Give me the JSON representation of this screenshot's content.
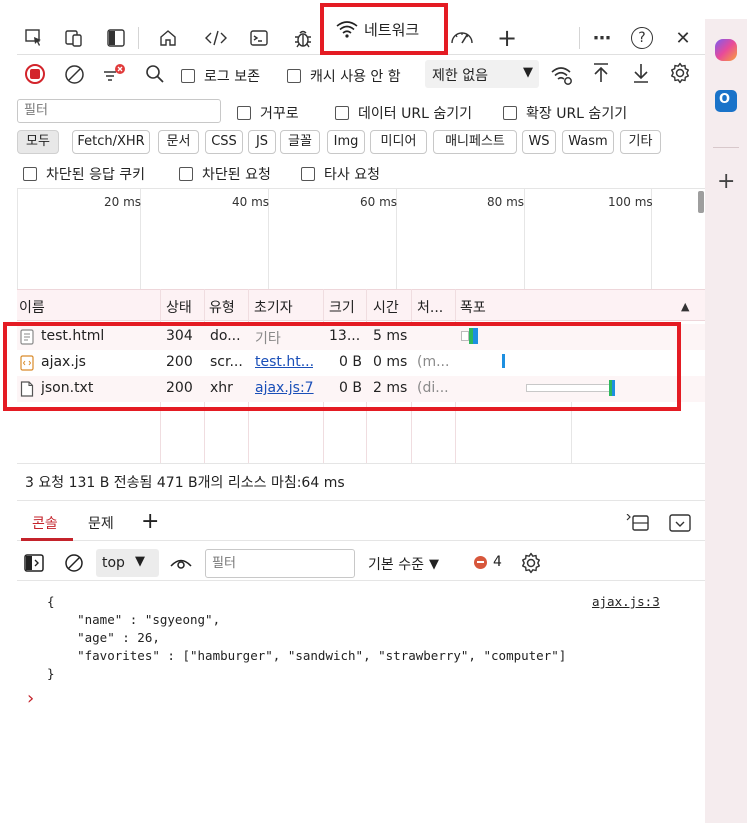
{
  "tabbar": {
    "active_tab_label": "네트워크",
    "more_label": "⋯",
    "help_label": "?",
    "close_label": "✕",
    "add_label": "+"
  },
  "toolbar2": {
    "preserve_log_label": "로그 보존",
    "disable_cache_label": "캐시 사용 안 함",
    "throttle_label": "제한 없음"
  },
  "filterrow": {
    "filter_placeholder": "필터",
    "invert_label": "거꾸로",
    "hide_data_url_label": "데이터 URL 숨기기",
    "hide_ext_url_label": "확장 URL 숨기기"
  },
  "chips": [
    "모두",
    "Fetch/XHR",
    "문서",
    "CSS",
    "JS",
    "글꼴",
    "Img",
    "미디어",
    "매니페스트",
    "WS",
    "Wasm",
    "기타"
  ],
  "blockrow": {
    "blocked_cookies_label": "차단된 응답 쿠키",
    "blocked_requests_label": "차단된 요청",
    "third_party_label": "타사 요청"
  },
  "overview": {
    "ticks": [
      "20 ms",
      "40 ms",
      "60 ms",
      "80 ms",
      "100 ms"
    ]
  },
  "table": {
    "headers": {
      "name": "이름",
      "status": "상태",
      "type": "유형",
      "initiator": "초기자",
      "size": "크기",
      "time": "시간",
      "priority": "처...",
      "waterfall": "폭포"
    },
    "rows": [
      {
        "name": "test.html",
        "status": "304",
        "type": "do...",
        "initiator": "기타",
        "size": "13...",
        "time": "5 ms",
        "priority": ""
      },
      {
        "name": "ajax.js",
        "status": "200",
        "type": "scr...",
        "initiator": "test.ht...",
        "size": "0 B",
        "time": "0 ms",
        "priority": "(m..."
      },
      {
        "name": "json.txt",
        "status": "200",
        "type": "xhr",
        "initiator": "ajax.js:7",
        "size": "0 B",
        "time": "2 ms",
        "priority": "(di..."
      }
    ]
  },
  "statusbar": {
    "text": "3 요청  131 B 전송됨  471 B개의 리소스  마침:64 ms"
  },
  "drawer": {
    "tab_console": "콘솔",
    "tab_issues": "문제",
    "add_label": "+"
  },
  "consolebar": {
    "context_label": "top",
    "filter_placeholder": "필터",
    "level_label": "기본 수준",
    "issues_count": "4"
  },
  "console": {
    "source_link": "ajax.js:3",
    "lines": [
      "{",
      "    \"name\" : \"sgyeong\",",
      "    \"age\" : 26,",
      "    \"favorites\" : [\"hamburger\", \"sandwich\", \"strawberry\", \"computer\"]",
      "}"
    ],
    "prompt": "›"
  },
  "colors": {
    "highlight_red": "#e41b23",
    "header_bg": "#fdf2f4",
    "link_blue": "#1a4fb8",
    "sidebar_bg": "#f5ecee"
  }
}
